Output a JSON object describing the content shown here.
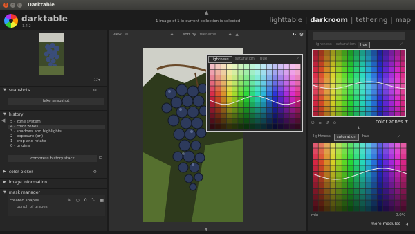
{
  "window": {
    "title": "Darktable",
    "close_glyph": "✕",
    "min_glyph": "–",
    "max_glyph": "□"
  },
  "app": {
    "name": "darktable",
    "version": "1.4.2",
    "views": [
      "lighttable",
      "darkroom",
      "tethering",
      "map"
    ],
    "active_view": "darkroom",
    "separator": "|",
    "selection_info": "1 image of 1 in current collection is selected"
  },
  "left_panel": {
    "snapshots": {
      "label": "snapshots",
      "take_button": "take snapshot"
    },
    "history": {
      "label": "history",
      "items": [
        "5 - zone system",
        "4 - color zones",
        "3 - shadows and highlights",
        "2 - exposure  (on)",
        "1 - crop and rotate",
        "0 - original"
      ],
      "current_index": 1,
      "compress_button": "compress history stack"
    },
    "color_picker": {
      "label": "color picker"
    },
    "image_information": {
      "label": "image information"
    },
    "mask_manager": {
      "label": "mask manager",
      "created_shapes": "created shapes",
      "shape_item": "bunch of grapes",
      "tool_glyphs": [
        "✎",
        "○",
        "0",
        "⤡",
        "▦"
      ]
    }
  },
  "center": {
    "view_label": "view",
    "view_value": "all",
    "sort_label": "sort by",
    "sort_value": "filename",
    "sort_dir": "▲",
    "group_label": "G"
  },
  "popup": {
    "tabs": [
      "lightness",
      "saturation",
      "hue"
    ],
    "active_tab": "lightness"
  },
  "right_panel": {
    "top_tabs": [
      "lightness",
      "saturation",
      "hue"
    ],
    "top_active_tab": "hue",
    "module_name": "color zones",
    "module_tabs": [
      "lightness",
      "saturation",
      "hue"
    ],
    "module_active_tab": "saturation",
    "mix_label": "mix",
    "mix_value": "0.0%",
    "more_modules": "more modules"
  },
  "icons": {
    "header_arrow": "triangle-up",
    "gear": "gear",
    "picker": "eyedropper"
  },
  "colors": {
    "background": "#1b1b1b",
    "panel": "#262626",
    "center": "#2f2f2f",
    "accent_logo": "#e33"
  }
}
